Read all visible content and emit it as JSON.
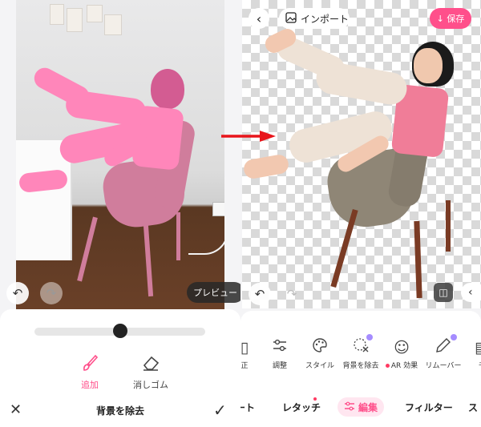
{
  "left_panel": {
    "preview_label": "プレビュー",
    "undo_icon": "undo-icon",
    "redo_icon": "redo-icon",
    "slider_value": 0.5,
    "tools": [
      {
        "id": "add",
        "label": "追加",
        "icon": "brush-icon",
        "active": true
      },
      {
        "id": "erase",
        "label": "消しゴム",
        "icon": "eraser-icon",
        "active": false
      }
    ],
    "title": "背景を除去",
    "close_icon": "close-icon",
    "confirm_icon": "checkmark-icon"
  },
  "right_panel": {
    "back_icon": "chevron-left-icon",
    "import_label": "インポート",
    "save_label": "↓ 保存",
    "tools": [
      {
        "label": "正",
        "icon": "adjust-icon"
      },
      {
        "label": "調整",
        "icon": "sliders-icon"
      },
      {
        "label": "スタイル",
        "icon": "palette-icon"
      },
      {
        "label": "背景を除去",
        "icon": "cutout-icon"
      },
      {
        "label": "AR 効果",
        "icon": "smiley-icon"
      },
      {
        "label": "リムーバー",
        "icon": "pen-icon"
      },
      {
        "label": "モ",
        "icon": "mosaic-icon"
      }
    ],
    "tabs": [
      {
        "label": "ート"
      },
      {
        "label": "レタッチ"
      },
      {
        "label": "編集"
      },
      {
        "label": "フィルター"
      },
      {
        "label": "ス"
      }
    ]
  },
  "colors": {
    "accent": "#ff4f8b",
    "mask_pink": "#ff86ba",
    "arrow_red": "#e8151b"
  }
}
